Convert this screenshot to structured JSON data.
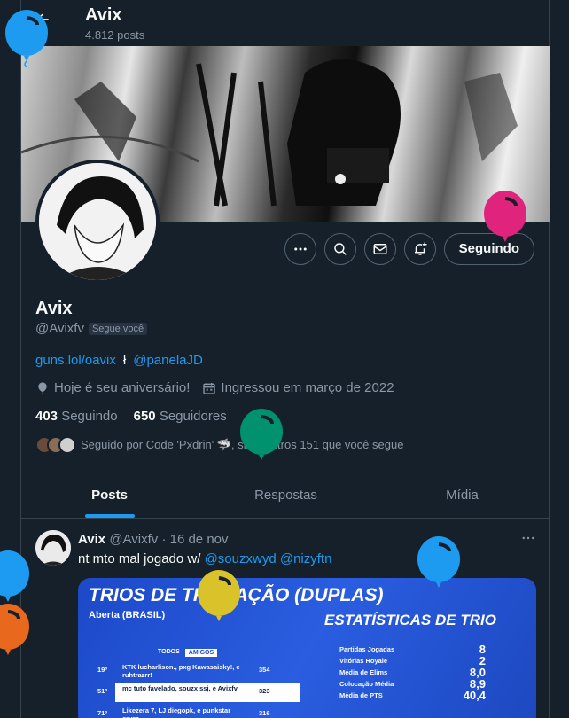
{
  "header": {
    "back_icon": "arrow-left-icon",
    "name": "Avix",
    "post_count": "4.812 posts"
  },
  "profile": {
    "name": "Avix",
    "handle": "@Avixfv",
    "follows_you": "Segue você",
    "link": "guns.lol/oavix",
    "separator": "ł",
    "mention": "@panelaJD",
    "birthday": "Hoje é seu aniversário!",
    "joined": "Ingressou em março de 2022",
    "following_count": "403",
    "following_label": "Seguindo",
    "followers_count": "650",
    "followers_label": "Seguidores",
    "followed_by": "Seguido por Code 'Pxdrin' 🦈, siz e outros 151 que você segue",
    "follow_button": "Seguindo"
  },
  "tabs": [
    {
      "label": "Posts",
      "active": true
    },
    {
      "label": "Respostas",
      "active": false
    },
    {
      "label": "Mídia",
      "active": false
    }
  ],
  "post": {
    "author": "Avix",
    "handle": "@Avixfv",
    "date": "· 16 de nov",
    "text_before": "nt mto mal jogado w/ ",
    "mention1": "@souzxwyd",
    "mention2": "@nizyftn",
    "media": {
      "title": "TRIOS DE TROCAÇÃO (DUPLAS)",
      "subtitle": "Aberta (BRASIL)",
      "stats_title": "ESTATÍSTICAS DE TRIO",
      "tab_all": "TODOS",
      "tab_friends": "AMIGOS",
      "ranks": [
        {
          "pos": "19º",
          "names": "KTK lucharlison., pxg Kawasaisky!, e ruhtrazrr!",
          "score": "354"
        },
        {
          "pos": "51º",
          "names": "mc tuto favelado, souzx ssj, e Avixfv",
          "score": "323"
        },
        {
          "pos": "71º",
          "names": "Likezera 7, LJ diegopk, e punkstar cryzz",
          "score": "316"
        }
      ],
      "stats": [
        {
          "label": "Partidas Jogadas",
          "value": "8"
        },
        {
          "label": "Vitórias Royale",
          "value": "2"
        },
        {
          "label": "Média de Elims",
          "value": "8,0"
        },
        {
          "label": "Colocação Média",
          "value": "8,9"
        },
        {
          "label": "Média de PTS",
          "value": "40,4"
        }
      ]
    }
  },
  "colors": {
    "background": "#15202b",
    "accent": "#1d9bf0",
    "muted": "#8b98a5",
    "border": "#38444d"
  }
}
